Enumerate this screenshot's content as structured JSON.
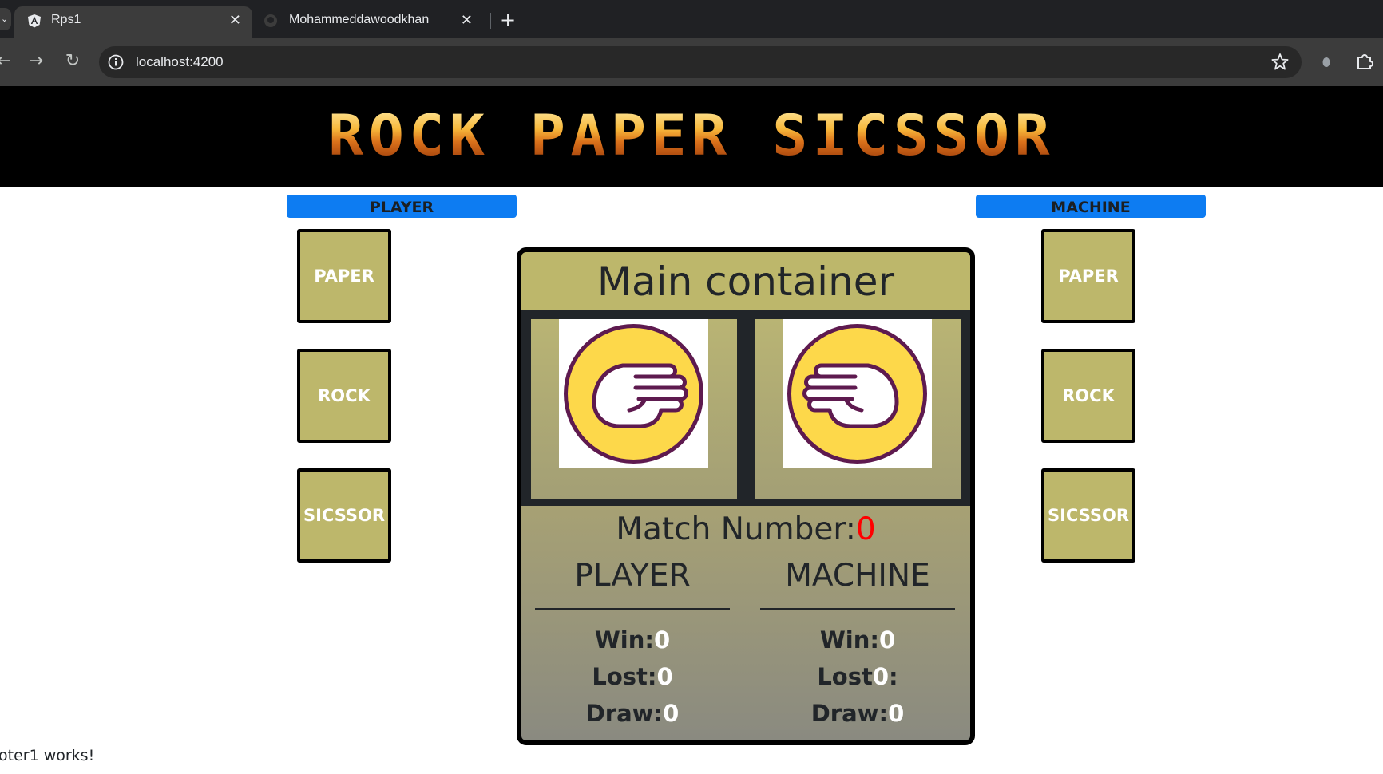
{
  "browser": {
    "tabs": [
      {
        "title": "Rps1",
        "favicon": "angular-icon",
        "active": true
      },
      {
        "title": "Mohammeddawoodkhan",
        "favicon": "github-icon",
        "active": false
      }
    ],
    "url": "localhost:4200"
  },
  "page": {
    "banner_title": "ROCK PAPER SICSSOR",
    "player_label": "PLAYER",
    "machine_label": "MACHINE",
    "player_choices": [
      "PAPER",
      "ROCK",
      "SICSSOR"
    ],
    "machine_choices": [
      "PAPER",
      "ROCK",
      "SICSSOR"
    ],
    "main_title": "Main container",
    "player_image": "rock-hand-icon",
    "machine_image": "rock-hand-icon",
    "match_label": "Match Number:",
    "match_number": "0",
    "player_column": {
      "title": "PLAYER",
      "win_label": "Win:",
      "win": "0",
      "lost_label": "Lost:",
      "lost": "0",
      "lost_suffix": "",
      "draw_label": "Draw:",
      "draw": "0"
    },
    "machine_column": {
      "title": "MACHINE",
      "win_label": "Win:",
      "win": "0",
      "lost_label": "Lost",
      "lost": "0",
      "lost_suffix": ":",
      "draw_label": "Draw:",
      "draw": "0"
    },
    "footer": "oter1 works!"
  },
  "colors": {
    "accent_blue": "#0d7cf2",
    "khaki": "#bdb76b",
    "match_number": "#ff0000",
    "hand_yellow": "#fdd84a",
    "hand_outline": "#5e1a4f"
  }
}
